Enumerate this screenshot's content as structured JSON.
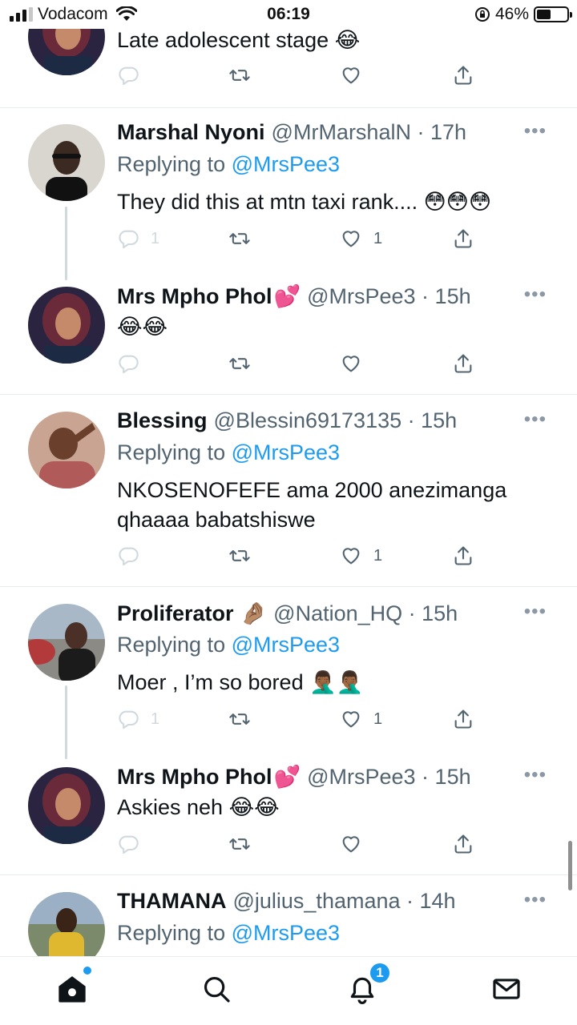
{
  "status_bar": {
    "carrier": "Vodacom",
    "time": "06:19",
    "battery": "46%",
    "battery_level": 0.46
  },
  "tweets": [
    {
      "body": "Late adolescent stage 😂",
      "reply_count": "",
      "like_count": ""
    },
    {
      "name": "Marshal Nyoni",
      "handle_time": "@MrMarshalN · 17h",
      "replying_prefix": "Replying to",
      "replying_mention": "@MrsPee3",
      "body": "They did this at mtn taxi rank.... 😳😳😳",
      "reply_count": "1",
      "like_count": "1"
    },
    {
      "name": "Mrs Mpho Phol",
      "name_emoji": "💕",
      "handle_time": "@MrsPee3 · 15h",
      "body": "😂😂",
      "reply_count": "",
      "like_count": ""
    },
    {
      "name": "Blessing",
      "handle_time": "@Blessin69173135 · 15h",
      "replying_prefix": "Replying to",
      "replying_mention": "@MrsPee3",
      "body_line1": "NKOSENOFEFE ama 2000 anezimanga",
      "body_line2": "qhaaaa babatshiswe",
      "reply_count": "",
      "like_count": "1"
    },
    {
      "name": "Proliferator",
      "name_emoji": "🤌🏽",
      "handle_time": "@Nation_HQ · 15h",
      "replying_prefix": "Replying to",
      "replying_mention": "@MrsPee3",
      "body": "Moer , I’m so bored 🤦🏾‍♂️🤦🏾‍♂️",
      "reply_count": "1",
      "like_count": "1"
    },
    {
      "name": "Mrs Mpho Phol",
      "name_emoji": "💕",
      "handle_time": "@MrsPee3 · 15h",
      "body": "Askies neh 😂😂",
      "reply_count": "",
      "like_count": ""
    },
    {
      "name": "THAMANA",
      "handle_time": "@julius_thamana · 14h",
      "replying_prefix": "Replying to",
      "replying_mention": "@MrsPee3"
    }
  ],
  "tab_bar": {
    "notifications_badge": "1"
  },
  "icons": {
    "reply": "reply-icon",
    "retweet": "retweet-icon",
    "like": "heart-icon",
    "share": "share-icon",
    "more": "more-icon",
    "home": "home-icon",
    "search": "search-icon",
    "notifications": "bell-icon",
    "messages": "mail-icon"
  },
  "colors": {
    "accent": "#1d9bf0",
    "secondary_text": "#536471",
    "divider": "#e6ecf0"
  }
}
